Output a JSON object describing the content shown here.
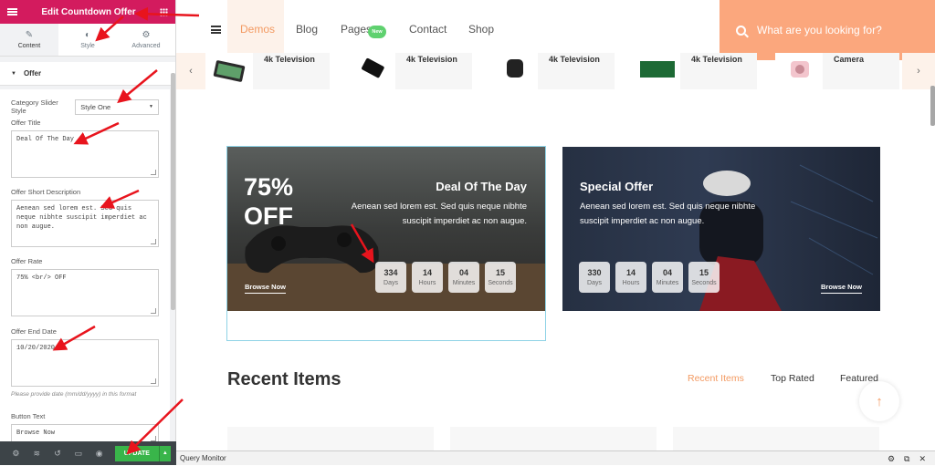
{
  "panel": {
    "title": "Edit Countdown Offer",
    "tabs": [
      {
        "label": "Content",
        "icon": "pencil-icon"
      },
      {
        "label": "Style",
        "icon": "contrast-icon"
      },
      {
        "label": "Advanced",
        "icon": "gear-icon"
      }
    ],
    "section": "Offer",
    "category_slider_style_label": "Category Slider Style",
    "category_slider_style_value": "Style One",
    "offer_title_label": "Offer Title",
    "offer_title_value": "Deal Of The Day",
    "offer_short_description_label": "Offer Short Description",
    "offer_short_description_value": "Aenean sed lorem est. Sed quis neque nibhte suscipit imperdiet ac non augue.",
    "offer_rate_label": "Offer Rate",
    "offer_rate_value": "75% <br/> OFF",
    "offer_end_date_label": "Offer End Date",
    "offer_end_date_value": "10/20/2020",
    "offer_end_date_hint": "Please provide date (mm/dd/yyyy) in this format",
    "button_text_label": "Button Text",
    "button_text_value": "Browse Now",
    "update_label": "UPDATE"
  },
  "nav": {
    "links": [
      "Demos",
      "Blog",
      "Pages",
      "Contact",
      "Shop"
    ],
    "new_badge": "New",
    "search_placeholder": "What are you looking for?",
    "accent": "#f39a62",
    "search_bg": "#fba77d"
  },
  "categories": [
    "4k Television",
    "4k Television",
    "4k Television",
    "4k Television",
    "Camera"
  ],
  "banner1": {
    "rate_line1": "75%",
    "rate_line2": "OFF",
    "title": "Deal Of The Day",
    "desc_line1": "Aenean sed lorem est. Sed quis neque nibhte",
    "desc_line2": "suscipit imperdiet ac non augue.",
    "browse": "Browse Now",
    "timer": [
      {
        "value": "334",
        "label": "Days"
      },
      {
        "value": "14",
        "label": "Hours"
      },
      {
        "value": "04",
        "label": "Minutes"
      },
      {
        "value": "15",
        "label": "Seconds"
      }
    ]
  },
  "banner2": {
    "title": "Special Offer",
    "desc_line1": "Aenean sed lorem est. Sed quis neque nibhte",
    "desc_line2": "suscipit imperdiet ac non augue.",
    "browse": "Browse Now",
    "timer": [
      {
        "value": "330",
        "label": "Days"
      },
      {
        "value": "14",
        "label": "Hours"
      },
      {
        "value": "04",
        "label": "Minutes"
      },
      {
        "value": "15",
        "label": "Seconds"
      }
    ]
  },
  "recent": {
    "title": "Recent Items",
    "tabs": [
      "Recent Items",
      "Top Rated",
      "Featured"
    ]
  },
  "query_monitor": "Query Monitor",
  "annotation_color": "#e8141d"
}
